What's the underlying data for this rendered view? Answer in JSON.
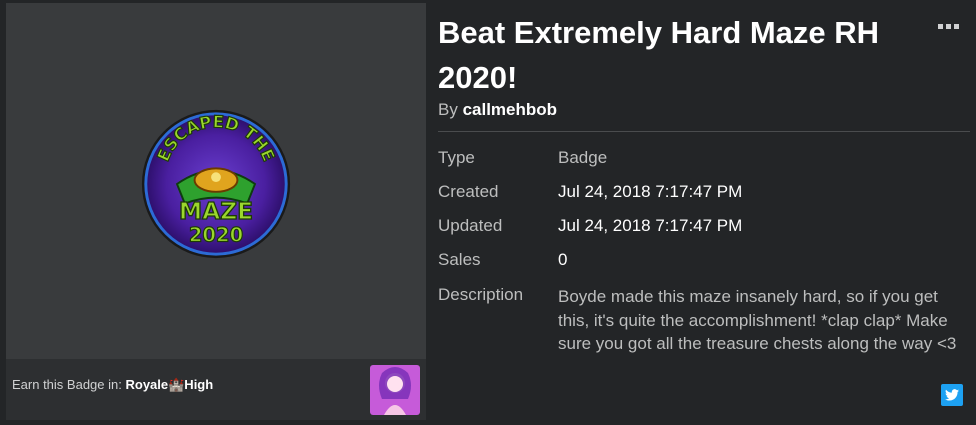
{
  "item": {
    "title": "Beat Extremely Hard Maze RH 2020!",
    "by_label": "By",
    "creator": "callmehbob"
  },
  "details": {
    "type_label": "Type",
    "type_value": "Badge",
    "created_label": "Created",
    "created_value": "Jul 24, 2018 7:17:47 PM",
    "updated_label": "Updated",
    "updated_value": "Jul 24, 2018 7:17:47 PM",
    "sales_label": "Sales",
    "sales_value": "0",
    "description_label": "Description",
    "description_value": "Boyde made this maze insanely hard, so if you get this, it's quite the accomplishment! *clap clap* Make sure you got all the treasure chests along the way <3"
  },
  "badge": {
    "art_text_top": "ESCAPED THE",
    "art_text_mid": "MAZE",
    "art_text_year": "2020"
  },
  "earn": {
    "label": "Earn this Badge in:",
    "game_name": "Royale🏰High"
  },
  "colors": {
    "background": "#232527",
    "panel": "#393b3d",
    "accent_twitter": "#1da1f2",
    "badge_green": "#9bd72d",
    "badge_purple": "#4a1fa0"
  },
  "icons": {
    "more": "more-options-icon",
    "share": "twitter-icon"
  }
}
